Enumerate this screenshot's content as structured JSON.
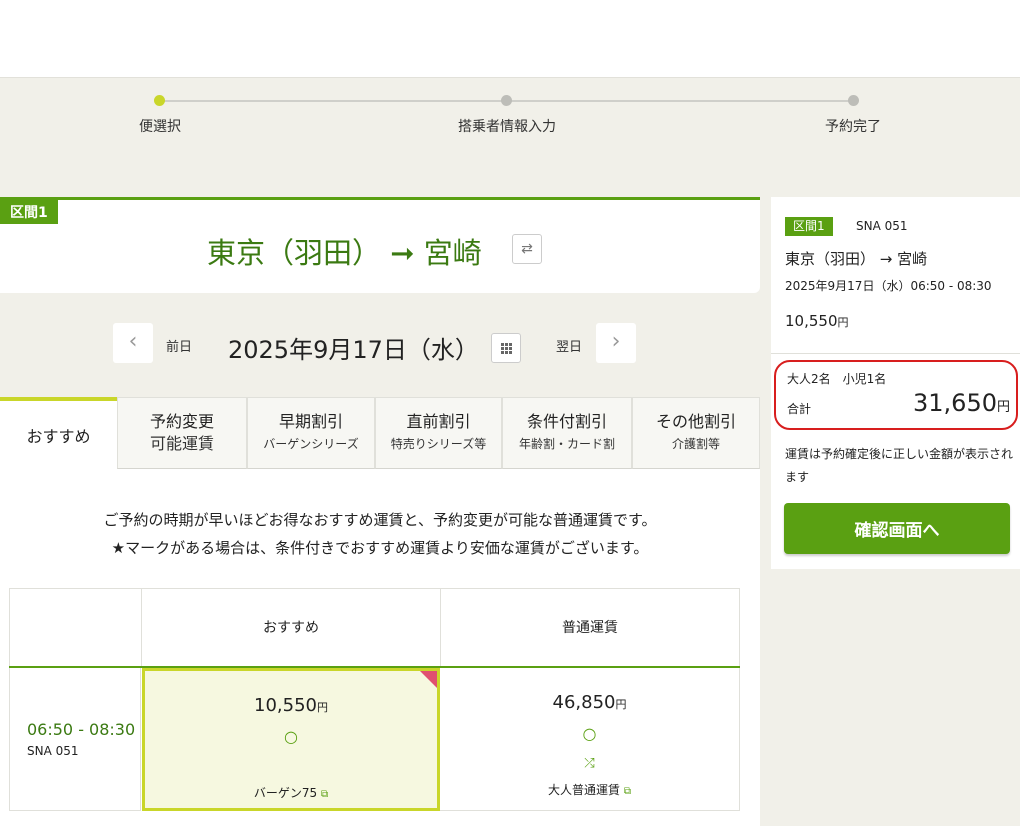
{
  "steps": [
    "便選択",
    "搭乗者情報入力",
    "予約完了"
  ],
  "route": {
    "section_tag": "区間1",
    "title": "東京（羽田） ➞ 宮崎",
    "swap_icon": "⇄"
  },
  "date_nav": {
    "prev_label": "前日",
    "next_label": "翌日",
    "date": "2025年9月17日（水）",
    "prev_icon": "‹",
    "next_icon": "›"
  },
  "tabs": [
    {
      "line1": "おすすめ",
      "line2": ""
    },
    {
      "line1": "予約変更",
      "line2": "可能運賃"
    },
    {
      "line1": "早期割引",
      "line2": "バーゲンシリーズ"
    },
    {
      "line1": "直前割引",
      "line2": "特売りシリーズ等"
    },
    {
      "line1": "条件付割引",
      "line2": "年齢割・カード割"
    },
    {
      "line1": "その他割引",
      "line2": "介護割等"
    }
  ],
  "description": {
    "line1": "ご予約の時期が早いほどお得なおすすめ運賃と、予約変更が可能な普通運賃です。",
    "line2": "★マークがある場合は、条件付きでおすすめ運賃より安価な運賃がございます。"
  },
  "fare_table": {
    "headers": [
      "おすすめ",
      "普通運賃"
    ],
    "rows": [
      {
        "time": "06:50 - 08:30",
        "flight": "SNA 051",
        "fares": [
          {
            "price": "10,550",
            "unit": "円",
            "availability": "○",
            "name": "バーゲン75",
            "selected": true
          },
          {
            "price": "46,850",
            "unit": "円",
            "availability": "○",
            "name": "大人普通運賃",
            "selected": false
          }
        ]
      }
    ]
  },
  "summary": {
    "section_tag": "区間1",
    "flight": "SNA 051",
    "route": "東京（羽田） → 宮崎",
    "datetime": "2025年9月17日（水）06:50 - 08:30",
    "price": "10,550",
    "unit": "円",
    "passengers": "大人2名　小児1名",
    "total_label": "合計",
    "total": "31,650",
    "note": "運賃は予約確定後に正しい金額が表示されます",
    "confirm_label": "確認画面へ"
  },
  "colors": {
    "brand_green": "#5aa012",
    "accent_lime": "#c9d62a",
    "highlight_red": "#d81e1e"
  }
}
